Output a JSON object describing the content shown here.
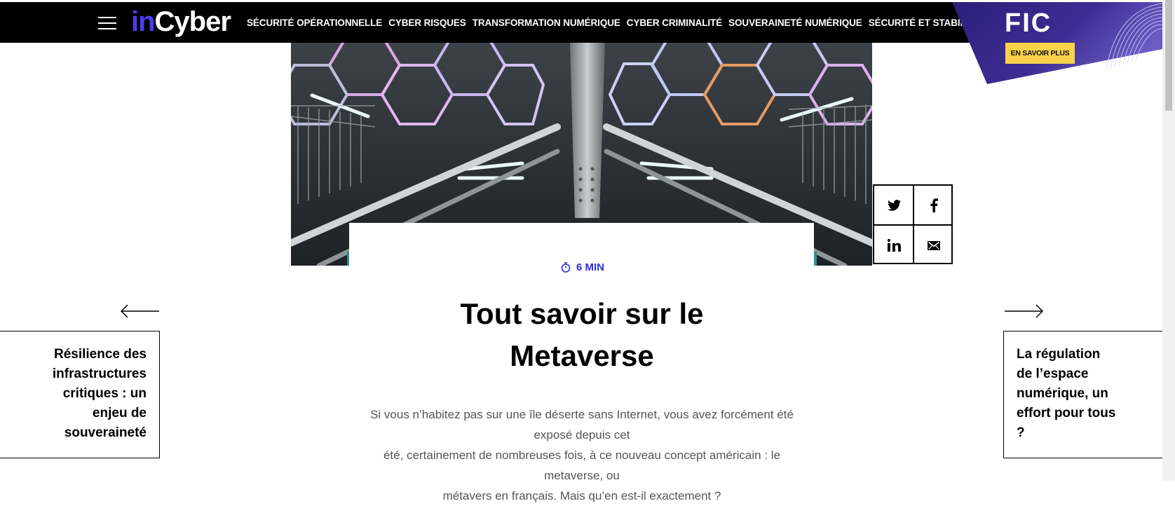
{
  "header": {
    "logo_in": "in",
    "logo_cyber": "Cyber",
    "nav": [
      "SÉCURITÉ OPÉRATIONNELLE",
      "CYBER RISQUES",
      "TRANSFORMATION NUMÉRIQUE",
      "CYBER CRIMINALITÉ",
      "SOUVERAINETÉ NUMÉRIQUE",
      "SÉCURITÉ ET STABILITÉ DU CYBERESPACE"
    ]
  },
  "promo": {
    "title": "FIC",
    "button": "EN SAVOIR PLUS"
  },
  "article": {
    "read_time": "6 MIN",
    "title_line1": "Tout savoir sur le",
    "title_line2": "Metaverse",
    "lead_line1": "Si vous n’habitez pas sur une île déserte sans Internet, vous avez forcément été exposé depuis cet",
    "lead_line2": "été, certainement de nombreuses fois, à ce nouveau concept américain : le metaverse, ou",
    "lead_line3": "métavers en français. Mais qu’en est-il exactement ?"
  },
  "prev_article": {
    "lines": [
      "Résilience des",
      "infrastructures",
      "critiques : un",
      "enjeu de",
      "souveraineté"
    ]
  },
  "next_article": {
    "lines": [
      "La régulation",
      "de l’espace",
      "numérique, un",
      "effort pour tous",
      "?"
    ]
  },
  "share": [
    "twitter-icon",
    "facebook-icon",
    "linkedin-icon",
    "email-icon"
  ],
  "colors": {
    "brand_blue": "#4a3cf0",
    "read_time": "#2b2bd9",
    "promo_bg": "#3a2c8c",
    "promo_button": "#f9d24a"
  }
}
